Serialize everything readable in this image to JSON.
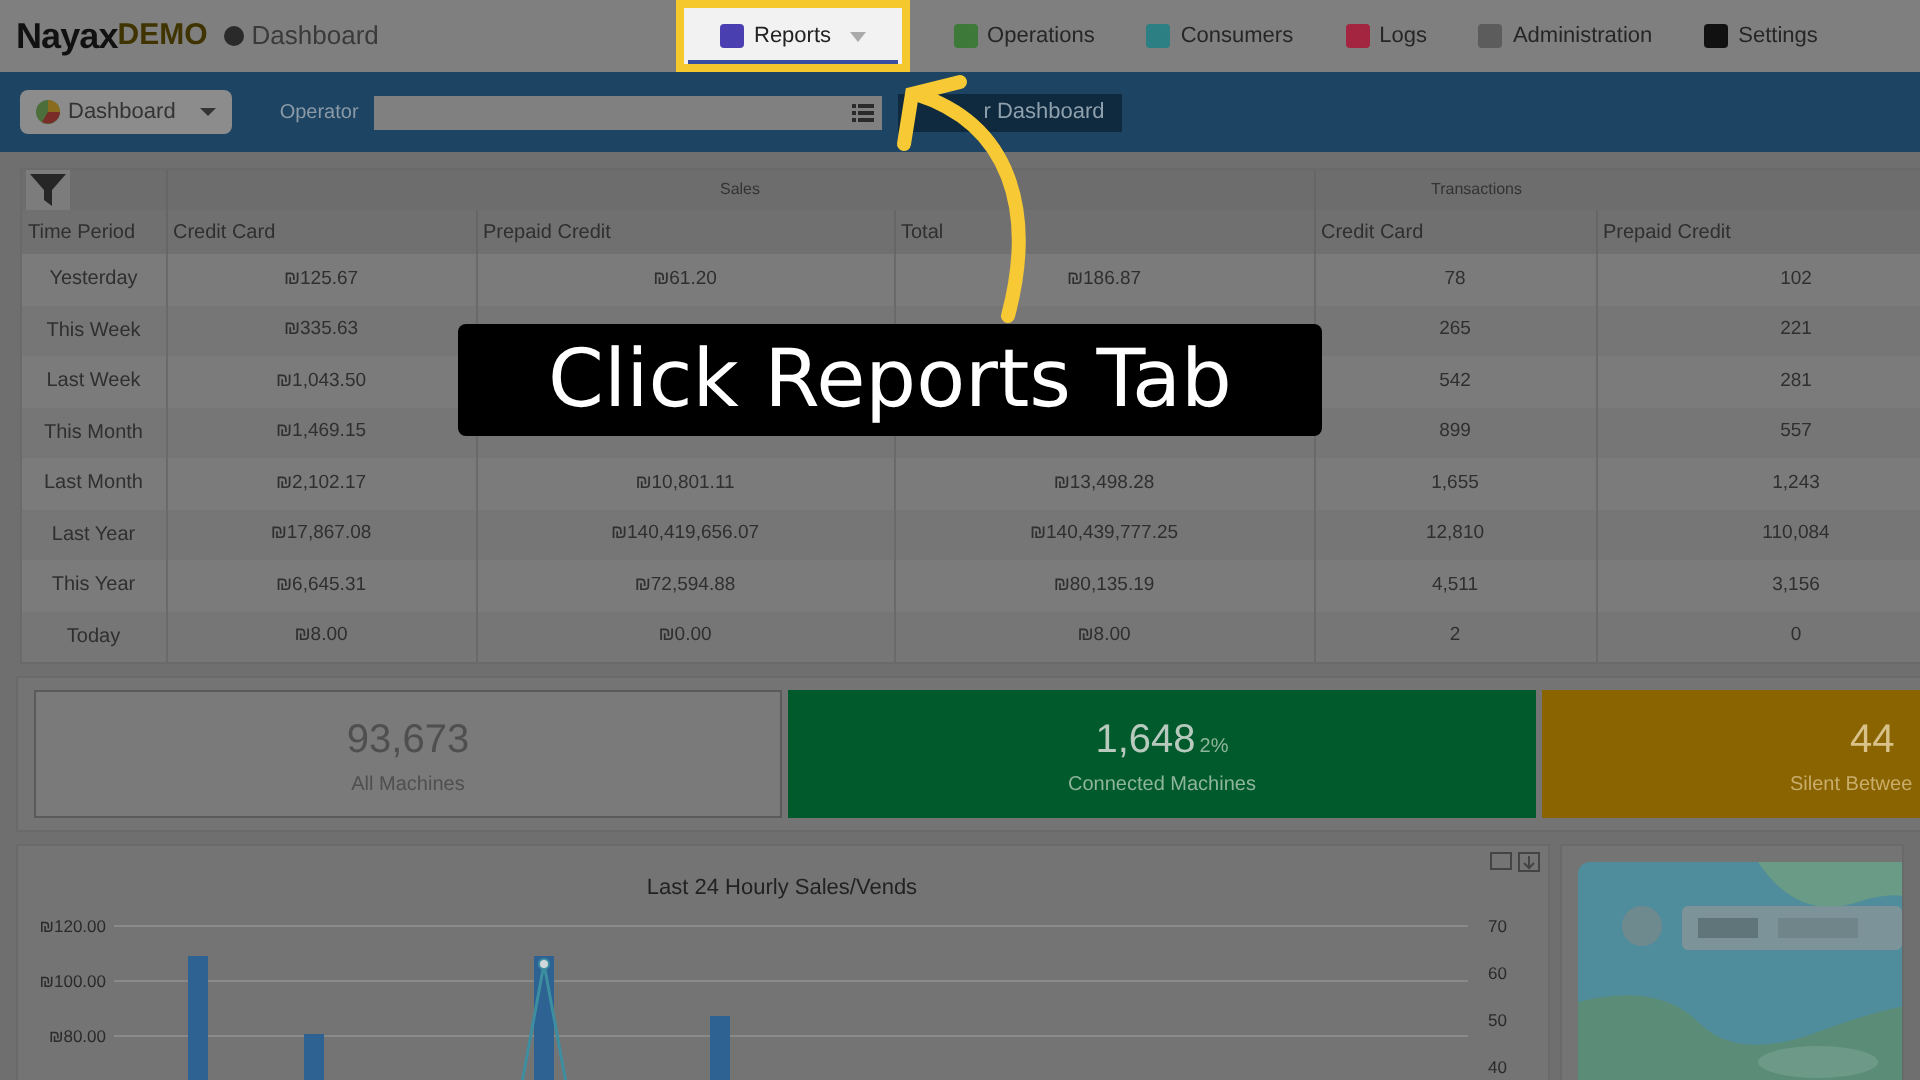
{
  "app": {
    "logo": "Nayax",
    "logo_suffix": "DEMO",
    "page": "Dashboard"
  },
  "nav": [
    {
      "label": "Reports",
      "selected": true,
      "dropdown": true
    },
    {
      "label": "Operations",
      "selected": false
    },
    {
      "label": "Consumers",
      "selected": false
    },
    {
      "label": "Logs",
      "selected": false
    },
    {
      "label": "Administration",
      "selected": false
    },
    {
      "label": "Settings",
      "selected": false
    }
  ],
  "toolbar": {
    "dashboard_button": "Dashboard",
    "operator_label": "Operator",
    "filter_button": "r Dashboard"
  },
  "table": {
    "groups": [
      "Sales",
      "Transactions"
    ],
    "columns": [
      "Time Period",
      "Credit Card",
      "Prepaid Credit",
      "Total",
      "Credit Card",
      "Prepaid Credit"
    ],
    "rows": [
      [
        "Yesterday",
        "₪125.67",
        "₪61.20",
        "₪186.87",
        "78",
        "102"
      ],
      [
        "This Week",
        "₪335.63",
        null,
        null,
        "265",
        "221"
      ],
      [
        "Last Week",
        "₪1,043.50",
        null,
        null,
        "542",
        "281"
      ],
      [
        "This Month",
        "₪1,469.15",
        null,
        null,
        "899",
        "557"
      ],
      [
        "Last Month",
        "₪2,102.17",
        "₪10,801.11",
        "₪13,498.28",
        "1,655",
        "1,243"
      ],
      [
        "Last Year",
        "₪17,867.08",
        "₪140,419,656.07",
        "₪140,439,777.25",
        "12,810",
        "110,084"
      ],
      [
        "This Year",
        "₪6,645.31",
        "₪72,594.88",
        "₪80,135.19",
        "4,511",
        "3,156"
      ],
      [
        "Today",
        "₪8.00",
        "₪0.00",
        "₪8.00",
        "2",
        "0"
      ]
    ]
  },
  "stats": [
    {
      "kind": "plain",
      "value": "93,673",
      "label": "All Machines"
    },
    {
      "kind": "good",
      "value": "1,648",
      "percent": "2%",
      "label": "Connected Machines"
    },
    {
      "kind": "warn",
      "value": "44",
      "label": "Silent Betwee"
    }
  ],
  "chart": {
    "title": "Last 24 Hourly Sales/Vends",
    "y_labels": [
      "₪120.00",
      "₪100.00",
      "₪80.00"
    ],
    "y2_labels": [
      "70",
      "60",
      "50",
      "40"
    ]
  },
  "tutorial": {
    "caption": "Click Reports Tab"
  }
}
